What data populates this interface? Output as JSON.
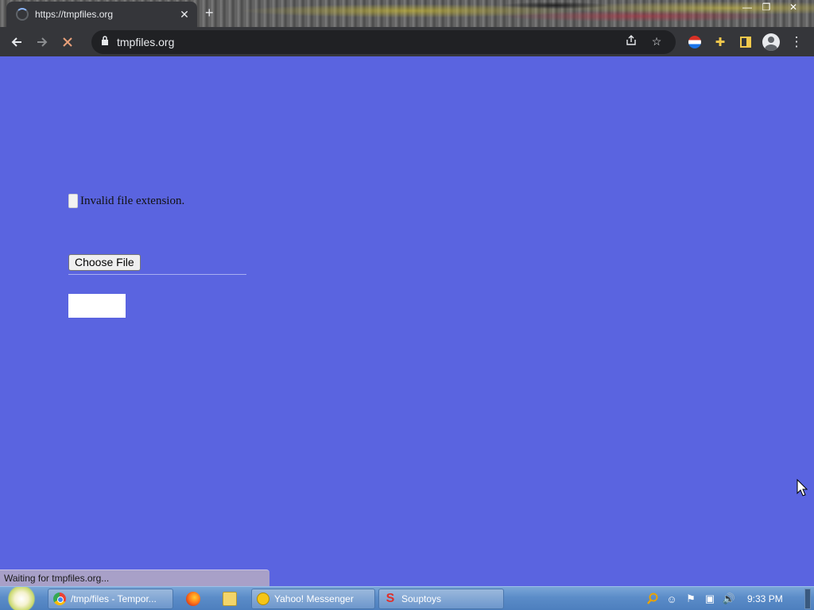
{
  "browser": {
    "tab_title": "https://tmpfiles.org",
    "tab_close_glyph": "✕",
    "new_tab_glyph": "+",
    "omnibox_url": "tmpfiles.org",
    "toolbar_icons": [
      "back-arrow-icon",
      "forward-arrow-icon",
      "stop-icon",
      "lock-icon",
      "share-icon",
      "star-icon",
      "flag-extension-icon",
      "puzzle-icon",
      "side-panel-icon",
      "profile-icon",
      "menu-icon"
    ],
    "window_controls": [
      "minimize",
      "restore",
      "close"
    ]
  },
  "page": {
    "error_message": "Invalid file extension.",
    "choose_file_label": "Choose File",
    "background_color": "#5a64e0"
  },
  "status_bar": {
    "text": "Waiting for tmpfiles.org..."
  },
  "taskbar": {
    "buttons": [
      {
        "label": "/tmp/files - Tempor...",
        "icon": "chrome-icon"
      },
      {
        "label": "Yahoo! Messenger",
        "icon": "yahoo-messenger-icon"
      },
      {
        "label": "Souptoys",
        "icon": "souptoys-icon"
      }
    ],
    "quick_launch": [
      "firefox-icon",
      "folder-icon"
    ],
    "tray_icons": [
      "search-tray-icon",
      "smiley-tray-icon",
      "flag-tray-icon",
      "network-tray-icon",
      "volume-tray-icon"
    ],
    "clock": "9:33 PM"
  }
}
